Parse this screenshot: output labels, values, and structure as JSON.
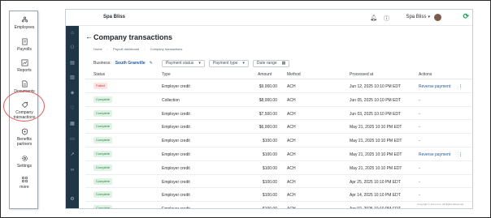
{
  "left_menu": {
    "items": [
      {
        "label": "Employees",
        "icon": "people-icon"
      },
      {
        "label": "Payrolls",
        "icon": "document-icon"
      },
      {
        "label": "Reports",
        "icon": "chart-icon"
      },
      {
        "label": "Documents",
        "icon": "file-icon"
      },
      {
        "label_line1": "Company",
        "label_line2": "transactions",
        "icon": "tag-icon"
      },
      {
        "label_line1": "Benefits",
        "label_line2": "partners",
        "icon": "shield-icon"
      },
      {
        "label": "Settings",
        "icon": "gear-icon"
      },
      {
        "label": "more",
        "icon": "grid-icon"
      }
    ]
  },
  "app": {
    "title": "Spa Bliss",
    "company_switcher": "Spa Bliss",
    "page_title": "Company transactions",
    "breadcrumb": [
      "Home",
      "Payroll dashboard",
      "Company transactions"
    ],
    "business_label": "Business:",
    "business_name": "South Granville",
    "filters": {
      "payment_status": "Payment status",
      "payment_type": "Payment type",
      "date_range": "Date range"
    },
    "columns": [
      "Status",
      "Type",
      "Amount",
      "Method",
      "Processed at",
      "Actions"
    ],
    "rows": [
      {
        "status": "Failed",
        "type": "Employer credit",
        "amount": "$9,000.00",
        "method": "ACH",
        "processed": "Jun 12, 2025 10:10 PM EDT",
        "action": "Reverse payment",
        "kebab": "⋮"
      },
      {
        "status": "Complete",
        "type": "Collection",
        "amount": "$8,000.00",
        "method": "ACH",
        "processed": "Jun 05, 2025 10:10 PM EDT",
        "action": "-",
        "kebab": ""
      },
      {
        "status": "Complete",
        "type": "Employer credit",
        "amount": "$7,500.00",
        "method": "ACH",
        "processed": "Jun 03, 2025 10:10 PM EDT",
        "action": "-",
        "kebab": ""
      },
      {
        "status": "Complete",
        "type": "Employer credit",
        "amount": "$6,000.00",
        "method": "ACH",
        "processed": "May 21, 2025 10:10 PM EDT",
        "action": "-",
        "kebab": ""
      },
      {
        "status": "Complete",
        "type": "Employer credit",
        "amount": "$100.00",
        "method": "ACH",
        "processed": "May 21, 2025 10:10 PM EDT",
        "action": "-",
        "kebab": ""
      },
      {
        "status": "Complete",
        "type": "Employer credit",
        "amount": "$100.00",
        "method": "ACH",
        "processed": "May 21, 2025 10:10 PM EDT",
        "action": "Reverse payment",
        "kebab": "⋮"
      },
      {
        "status": "Complete",
        "type": "Employer credit",
        "amount": "$100.00",
        "method": "ACH",
        "processed": "May 21, 2025 10:10 PM EDT",
        "action": "-",
        "kebab": ""
      },
      {
        "status": "Complete",
        "type": "Employer credit",
        "amount": "$100.00",
        "method": "ACH",
        "processed": "Apr 25, 2025 10:10 PM EDT",
        "action": "-",
        "kebab": ""
      },
      {
        "status": "Complete",
        "type": "Employer credit",
        "amount": "$100.00",
        "method": "ACH",
        "processed": "Apr 14, 2025 10:10 PM EDT",
        "action": "-",
        "kebab": ""
      },
      {
        "status": "Complete",
        "type": "Employer credit",
        "amount": "$100.00",
        "method": "ACH",
        "processed": "Apr 02, 2025 10:10 PM EDT",
        "action": "-",
        "kebab": ""
      }
    ],
    "copyright": "Copyright © Zoom Inc. All Rights Reserved."
  },
  "colors": {
    "rail": "#1f3646",
    "link": "#1e5aa8",
    "brand_green": "#1a9e5c",
    "highlight": "#e05a5a"
  }
}
